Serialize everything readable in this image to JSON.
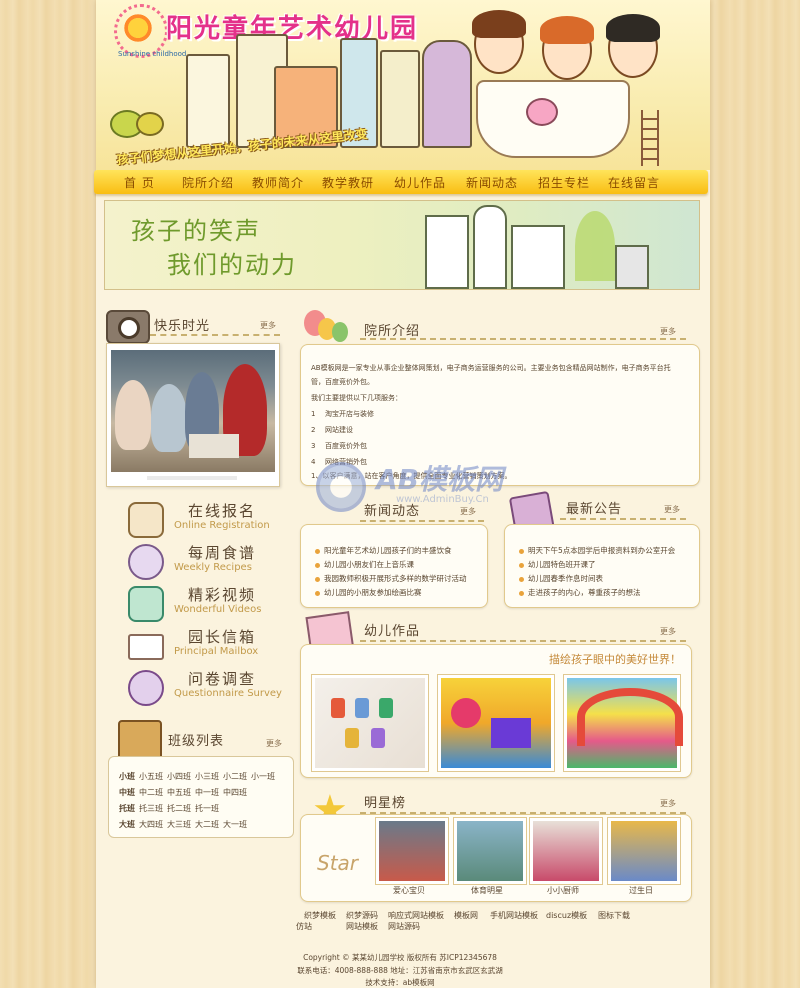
{
  "header": {
    "title": "阳光童年艺术幼儿园",
    "subtitle": "Sunshine childhood",
    "slogan": "孩子们梦想从这里开始，孩子的未来从这里改变"
  },
  "nav": [
    "首 页",
    "院所介绍",
    "教师简介",
    "教学教研",
    "幼儿作品",
    "新闻动态",
    "招生专栏",
    "在线留言"
  ],
  "banner": {
    "line1": "孩子的笑声",
    "line2": "我们的动力"
  },
  "happy_time": {
    "title": "快乐时光",
    "more": "更多"
  },
  "quick_links": [
    {
      "cn": "在线报名",
      "en": "Online Registration",
      "icon": "pen-icon"
    },
    {
      "cn": "每周食谱",
      "en": "Weekly Recipes",
      "icon": "pan-icon"
    },
    {
      "cn": "精彩视频",
      "en": "Wonderful Videos",
      "icon": "video-icon"
    },
    {
      "cn": "园长信箱",
      "en": "Principal Mailbox",
      "icon": "mail-icon"
    },
    {
      "cn": "问卷调查",
      "en": "Questionnaire Survey",
      "icon": "question-icon"
    }
  ],
  "classes": {
    "title": "班级列表",
    "more": "更多",
    "rows": [
      {
        "grade": "小班",
        "items": [
          "小五班",
          "小四班",
          "小三班",
          "小二班",
          "小一班"
        ]
      },
      {
        "grade": "中班",
        "items": [
          "中二班",
          "中五班",
          "中一班",
          "中四班"
        ]
      },
      {
        "grade": "托班",
        "items": [
          "托三班",
          "托二班",
          "托一班"
        ]
      },
      {
        "grade": "大班",
        "items": [
          "大四班",
          "大三班",
          "大二班",
          "大一班"
        ]
      }
    ]
  },
  "intro": {
    "title": "院所介绍",
    "more": "更多",
    "p1": "AB模板网是一家专业从事企业整体网策划，电子商务运营服务的公司。主要业务包含精品网站制作，电子商务平台托",
    "p2": "管，百度竞价外包。",
    "p3": "我们主要提供以下几项服务：",
    "items": [
      "淘宝开店与装修",
      "网站建设",
      "百度竞价外包",
      "网络营销外包"
    ],
    "item_nums": [
      "1",
      "2",
      "3",
      "4"
    ],
    "tail": "1、以客户满意，站在客户角度，提供全面专业化营销策划方案。"
  },
  "news": {
    "title": "新闻动态",
    "more": "更多",
    "items": [
      "阳光童年艺术幼儿园孩子们的丰盛饮食",
      "幼儿园小朋友们在上音乐课",
      "我园教师积极开展形式多样的数学研讨活动",
      "幼儿园的小朋友参加绘画比赛"
    ]
  },
  "notice": {
    "title": "最新公告",
    "more": "更多",
    "items": [
      "明天下午5点本园学后申报资料到办公室开会",
      "幼儿园特色班开课了",
      "幼儿园春季作息时间表",
      "走进孩子的内心，尊重孩子的想法"
    ]
  },
  "works": {
    "title": "幼儿作品",
    "more": "更多",
    "slogan": "描绘孩子眼中的美好世界！"
  },
  "stars": {
    "title": "明星榜",
    "more": "更多",
    "names": [
      "爱心宝贝",
      "体育明星",
      "小小厨师",
      "过生日"
    ]
  },
  "footer_links": [
    "织梦模板",
    "织梦源码",
    "响应式网站模板",
    "模板网",
    "手机网站模板",
    "discuz模板",
    "图标下载",
    "仿站",
    "网站模板",
    "网站源码"
  ],
  "footer": {
    "copyright": "Copyright © 某某幼儿园学校 版权所有 苏ICP12345678",
    "contact": "联系电话：4008-888-888    地址：江苏省南京市玄武区玄武湖",
    "support": "技术支持：ab模板网"
  },
  "watermark": {
    "text": "AB模板网",
    "sub": "www.AdminBuy.Cn"
  },
  "colors": {
    "accent": "#f9bd12",
    "title_pink": "#e4318a",
    "banner_green": "#6f9a2c"
  }
}
